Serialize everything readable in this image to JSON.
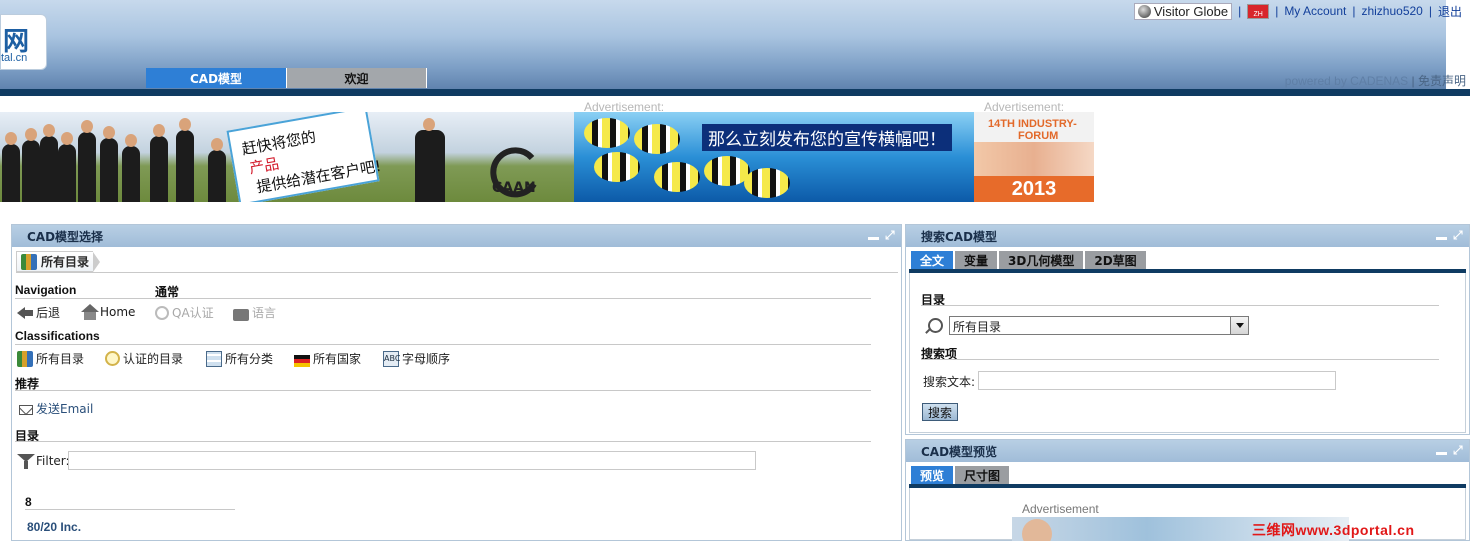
{
  "header": {
    "logo_main": "网",
    "logo_sub": "tal.cn",
    "visitor_globe": "Visitor Globe",
    "lang_flag": "ZH",
    "my_account": "My Account",
    "username": "zhizhuo520",
    "logout": "退出",
    "powered_by": "powered by CADENAS",
    "disclaimer": "免责声明"
  },
  "main_tabs": [
    {
      "label": "CAD模型",
      "active": true
    },
    {
      "label": "欢迎",
      "active": false
    }
  ],
  "ads": {
    "label": "Advertisement:",
    "banner1_line1": "赶快将您的",
    "banner1_line2": "产品",
    "banner1_line3": "提供给潜在客户吧!",
    "banner1_brand": "CAAN",
    "banner2_text": "那么立刻发布您的宣传横幅吧！",
    "banner3_line1": "14TH INDUSTRY-",
    "banner3_line2": "FORUM",
    "banner3_year": "2013"
  },
  "left_panel": {
    "title": "CAD模型选择",
    "breadcrumb": "所有目录",
    "navigation_head": "Navigation",
    "general_head": "通常",
    "nav_items": [
      {
        "label": "后退",
        "icon": "back-arrow-icon",
        "enabled": true
      },
      {
        "label": "Home",
        "icon": "home-icon",
        "enabled": true
      },
      {
        "label": "QA认证",
        "icon": "qa-icon",
        "enabled": false
      },
      {
        "label": "语言",
        "icon": "language-icon",
        "enabled": false
      }
    ],
    "classifications_head": "Classifications",
    "class_items": [
      {
        "label": "所有目录",
        "icon": "books-icon"
      },
      {
        "label": "认证的目录",
        "icon": "certificate-icon"
      },
      {
        "label": "所有分类",
        "icon": "classes-icon"
      },
      {
        "label": "所有国家",
        "icon": "flags-icon"
      },
      {
        "label": "字母顺序",
        "icon": "alphabet-icon"
      }
    ],
    "recommend_head": "推荐",
    "send_email": "发送Email",
    "catalog_head": "目录",
    "filter_label": "Filter:",
    "filter_value": "",
    "group_letter": "8",
    "group_item": "80/20 Inc."
  },
  "search_panel": {
    "title": "搜索CAD模型",
    "tabs": [
      {
        "label": "全文",
        "active": true
      },
      {
        "label": "变量",
        "active": false
      },
      {
        "label": "3D几何模型",
        "active": false
      },
      {
        "label": "2D草图",
        "active": false
      }
    ],
    "catalog_head": "目录",
    "catalog_selected": "所有目录",
    "search_items_head": "搜索项",
    "search_text_label": "搜索文本:",
    "search_text_value": "",
    "search_button": "搜索"
  },
  "preview_panel": {
    "title": "CAD模型预览",
    "tabs": [
      {
        "label": "预览",
        "active": true
      },
      {
        "label": "尺寸图",
        "active": false
      }
    ],
    "ad_label": "Advertisement"
  },
  "watermark": "三维网www.3dportal.cn",
  "colors": {
    "accent_blue": "#2e7fd6",
    "dark_bar": "#0f3b62",
    "panel_title": "#a0bcd8"
  }
}
